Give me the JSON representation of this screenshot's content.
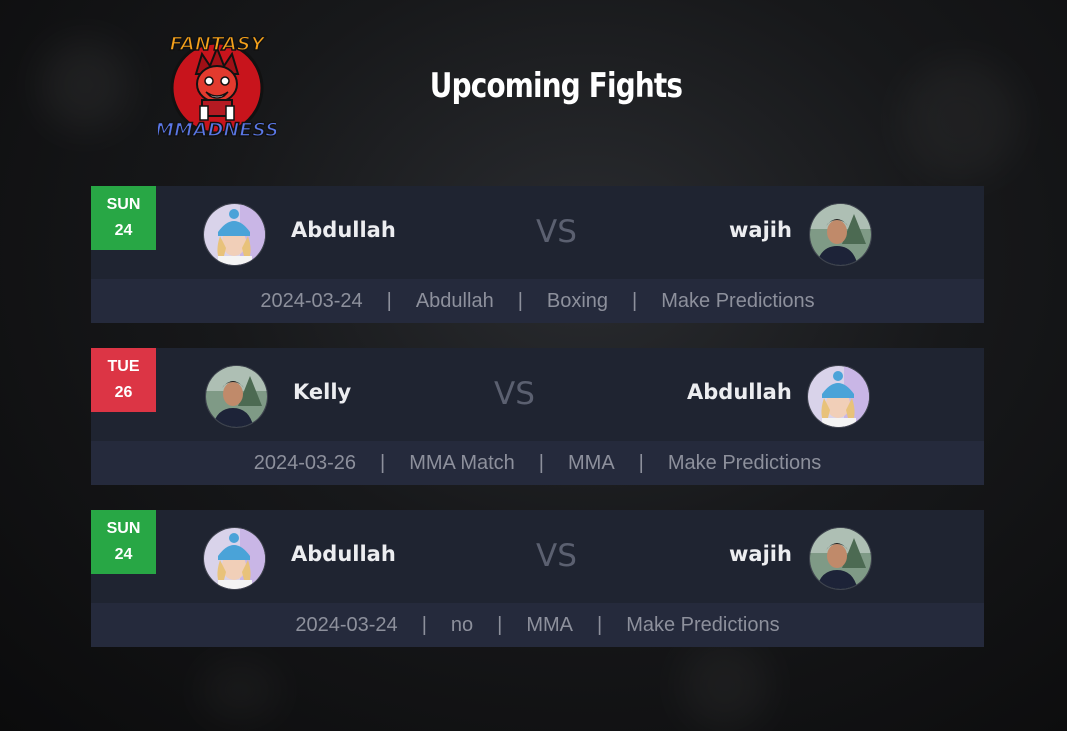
{
  "page": {
    "title": "Upcoming Fights"
  },
  "logo": {
    "name": "fantasy-mmadness-logo",
    "text_top": "FANTASY",
    "text_bottom": "MMADNESS"
  },
  "fights": [
    {
      "badge": {
        "day": "SUN",
        "date": "24",
        "color": "#28a745"
      },
      "fighter_left": {
        "name": "Abdullah",
        "avatar": "avatar-woman-beanie"
      },
      "vs": "VS",
      "fighter_right": {
        "name": "wajih",
        "avatar": "avatar-man-outdoor"
      },
      "info": {
        "date": "2024-03-24",
        "event": "Abdullah",
        "type": "Boxing",
        "action": "Make Predictions"
      }
    },
    {
      "badge": {
        "day": "TUE",
        "date": "26",
        "color": "#dc3545"
      },
      "fighter_left": {
        "name": "Kelly",
        "avatar": "avatar-man-outdoor"
      },
      "vs": "VS",
      "fighter_right": {
        "name": "Abdullah",
        "avatar": "avatar-woman-beanie"
      },
      "info": {
        "date": "2024-03-26",
        "event": "MMA Match",
        "type": "MMA",
        "action": "Make Predictions"
      }
    },
    {
      "badge": {
        "day": "SUN",
        "date": "24",
        "color": "#28a745"
      },
      "fighter_left": {
        "name": "Abdullah",
        "avatar": "avatar-woman-beanie"
      },
      "vs": "VS",
      "fighter_right": {
        "name": "wajih",
        "avatar": "avatar-man-outdoor"
      },
      "info": {
        "date": "2024-03-24",
        "event": "no",
        "type": "MMA",
        "action": "Make Predictions"
      }
    }
  ],
  "separator": "|"
}
